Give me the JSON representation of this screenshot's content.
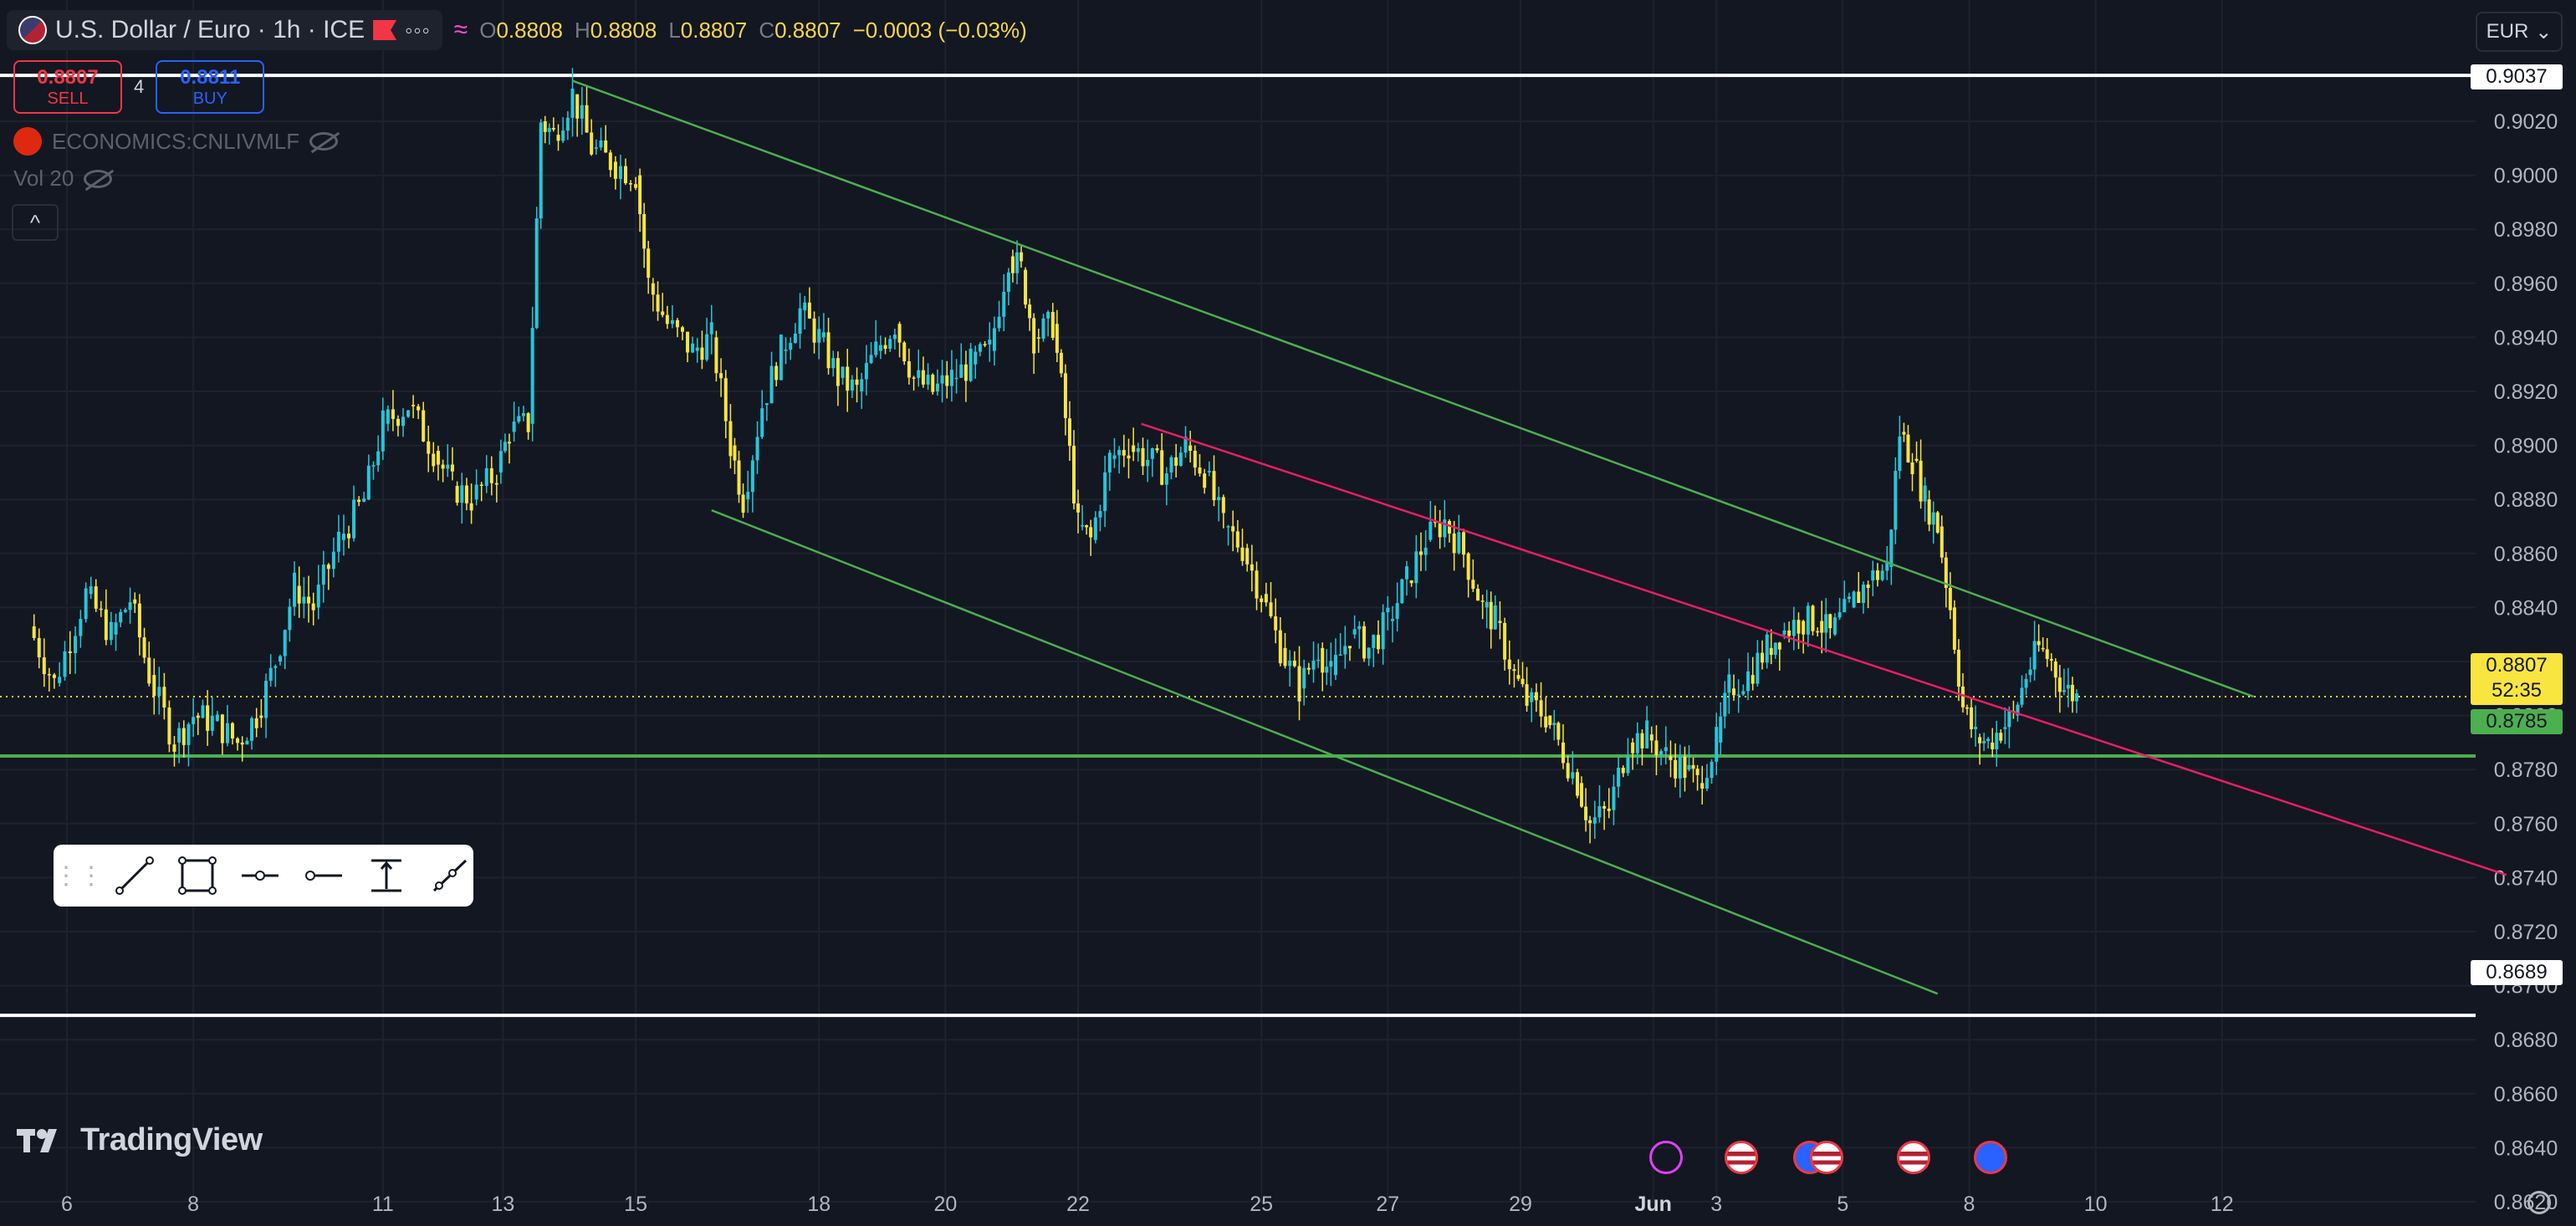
{
  "header": {
    "symbol_title": "U.S. Dollar / Euro · 1h · ICE",
    "menu_dots": "◦◦◦",
    "indicator_symbol": "≈",
    "ohlc": {
      "o_label": "O",
      "o": "0.8808",
      "h_label": "H",
      "h": "0.8808",
      "l_label": "L",
      "l": "0.8807",
      "c_label": "C",
      "c": "0.8807",
      "change": "−0.0003 (−0.03%)"
    }
  },
  "trade": {
    "sell_price": "0.8807",
    "sell_label": "SELL",
    "spread": "4",
    "buy_price": "0.8811",
    "buy_label": "BUY"
  },
  "indicators": [
    {
      "label": "ECONOMICS:CNLIVMLF"
    },
    {
      "label": "Vol 20"
    }
  ],
  "collapse_label": "^",
  "currency": {
    "label": "EUR",
    "chevron": "⌄"
  },
  "logo_text": "TradingView",
  "chart_data": {
    "type": "candlestick",
    "symbol": "U.S. Dollar / Euro",
    "interval": "1h",
    "ylim": [
      0.861,
      0.9045
    ],
    "y_ticks": [
      "0.9020",
      "0.9000",
      "0.8980",
      "0.8960",
      "0.8940",
      "0.8920",
      "0.8900",
      "0.8880",
      "0.8860",
      "0.8840",
      "0.8820",
      "0.8800",
      "0.8780",
      "0.8760",
      "0.8740",
      "0.8720",
      "0.8700",
      "0.8680",
      "0.8660",
      "0.8640",
      "0.8620"
    ],
    "x_ticks": [
      "6",
      "8",
      "11",
      "13",
      "15",
      "18",
      "20",
      "22",
      "25",
      "27",
      "29",
      "Jun",
      "3",
      "5",
      "8",
      "10",
      "12"
    ],
    "path": [
      [
        -0.6,
        0.8833
      ],
      [
        -0.2,
        0.8812
      ],
      [
        0.3,
        0.8845
      ],
      [
        0.7,
        0.883
      ],
      [
        1.0,
        0.8843
      ],
      [
        1.3,
        0.8815
      ],
      [
        1.7,
        0.879
      ],
      [
        2.0,
        0.88
      ],
      [
        2.3,
        0.8798
      ],
      [
        2.7,
        0.879
      ],
      [
        3.0,
        0.88
      ],
      [
        3.3,
        0.882
      ],
      [
        3.6,
        0.8848
      ],
      [
        3.9,
        0.884
      ],
      [
        4.3,
        0.8865
      ],
      [
        4.7,
        0.888
      ],
      [
        5.0,
        0.8908
      ],
      [
        5.4,
        0.8915
      ],
      [
        5.8,
        0.8898
      ],
      [
        6.1,
        0.8885
      ],
      [
        6.4,
        0.888
      ],
      [
        6.8,
        0.889
      ],
      [
        7.0,
        0.8905
      ],
      [
        7.3,
        0.8908
      ],
      [
        7.5,
        0.902
      ],
      [
        7.7,
        0.9015
      ],
      [
        8.0,
        0.903
      ],
      [
        8.3,
        0.901
      ],
      [
        8.6,
        0.9005
      ],
      [
        9.0,
        0.9
      ],
      [
        9.2,
        0.896
      ],
      [
        9.5,
        0.8945
      ],
      [
        9.9,
        0.8935
      ],
      [
        10.2,
        0.894
      ],
      [
        10.5,
        0.89
      ],
      [
        10.7,
        0.888
      ],
      [
        11.0,
        0.8915
      ],
      [
        11.3,
        0.8935
      ],
      [
        11.6,
        0.895
      ],
      [
        11.9,
        0.894
      ],
      [
        12.2,
        0.8925
      ],
      [
        12.5,
        0.892
      ],
      [
        12.8,
        0.8935
      ],
      [
        13.1,
        0.8945
      ],
      [
        13.4,
        0.8925
      ],
      [
        13.7,
        0.892
      ],
      [
        14.0,
        0.8925
      ],
      [
        14.3,
        0.893
      ],
      [
        14.6,
        0.8935
      ],
      [
        14.9,
        0.897
      ],
      [
        15.1,
        0.8965
      ],
      [
        15.3,
        0.894
      ],
      [
        15.6,
        0.8945
      ],
      [
        15.8,
        0.891
      ],
      [
        16.0,
        0.887
      ],
      [
        16.2,
        0.8865
      ],
      [
        16.5,
        0.8895
      ],
      [
        16.8,
        0.89
      ],
      [
        17.1,
        0.8895
      ],
      [
        17.4,
        0.889
      ],
      [
        17.7,
        0.89
      ],
      [
        18.0,
        0.889
      ],
      [
        18.3,
        0.887
      ],
      [
        18.6,
        0.8862
      ],
      [
        18.9,
        0.8845
      ],
      [
        19.2,
        0.8825
      ],
      [
        19.5,
        0.881
      ],
      [
        19.8,
        0.8825
      ],
      [
        20.0,
        0.8815
      ],
      [
        20.3,
        0.883
      ],
      [
        20.6,
        0.8825
      ],
      [
        20.9,
        0.8835
      ],
      [
        21.2,
        0.885
      ],
      [
        21.5,
        0.8865
      ],
      [
        21.8,
        0.8872
      ],
      [
        22.1,
        0.886
      ],
      [
        22.4,
        0.884
      ],
      [
        22.6,
        0.8835
      ],
      [
        22.9,
        0.8815
      ],
      [
        23.1,
        0.8805
      ],
      [
        23.4,
        0.88
      ],
      [
        23.6,
        0.879
      ],
      [
        23.9,
        0.8775
      ],
      [
        24.1,
        0.876
      ],
      [
        24.4,
        0.8765
      ],
      [
        24.7,
        0.879
      ],
      [
        25.0,
        0.8793
      ],
      [
        25.3,
        0.8785
      ],
      [
        25.6,
        0.878
      ],
      [
        25.8,
        0.8775
      ],
      [
        26.1,
        0.879
      ],
      [
        26.3,
        0.881
      ],
      [
        26.6,
        0.8815
      ],
      [
        26.9,
        0.8825
      ],
      [
        27.1,
        0.883
      ],
      [
        27.4,
        0.8835
      ],
      [
        27.7,
        0.8835
      ],
      [
        27.9,
        0.883
      ],
      [
        28.2,
        0.884
      ],
      [
        28.5,
        0.885
      ],
      [
        28.8,
        0.8855
      ],
      [
        29.0,
        0.8905
      ],
      [
        29.2,
        0.8895
      ],
      [
        29.4,
        0.888
      ],
      [
        29.6,
        0.887
      ],
      [
        29.8,
        0.884
      ],
      [
        30.0,
        0.8803
      ],
      [
        30.2,
        0.8792
      ],
      [
        30.4,
        0.879
      ],
      [
        30.6,
        0.8795
      ],
      [
        30.8,
        0.88
      ],
      [
        31.0,
        0.8815
      ],
      [
        31.2,
        0.8825
      ],
      [
        31.4,
        0.882
      ],
      [
        31.6,
        0.881
      ],
      [
        31.8,
        0.8807
      ]
    ],
    "x_domain": [
      -0.7,
      47
    ],
    "horizontal_levels": [
      {
        "label": "0.9037",
        "value": 0.9037,
        "color": "#ffffff"
      },
      {
        "label": "0.8785",
        "value": 0.8785,
        "color": "#4caf50"
      },
      {
        "label": "0.8689",
        "value": 0.8689,
        "color": "#ffffff"
      }
    ],
    "last_price": {
      "label": "0.8807",
      "value": 0.8807,
      "countdown": "52:35",
      "color": "#f9e53f"
    },
    "trendlines": [
      {
        "color": "#4caf50",
        "from": [
          8.0,
          0.9035
        ],
        "to": [
          34.6,
          0.8807
        ]
      },
      {
        "color": "#4caf50",
        "from": [
          10.2,
          0.8876
        ],
        "to": [
          29.6,
          0.8697
        ]
      },
      {
        "color": "#e91e63",
        "from": [
          17.0,
          0.8908
        ],
        "to": [
          38.6,
          0.8741
        ]
      }
    ],
    "up_color": "#26c6da",
    "down_color": "#f9e53f"
  },
  "events": [
    {
      "name": "lightning-event-icon"
    },
    {
      "name": "us-event-icon"
    },
    {
      "name": "eu-event-icon"
    },
    {
      "name": "us-event-icon"
    },
    {
      "name": "us-event-icon"
    },
    {
      "name": "eu-event-icon"
    }
  ]
}
